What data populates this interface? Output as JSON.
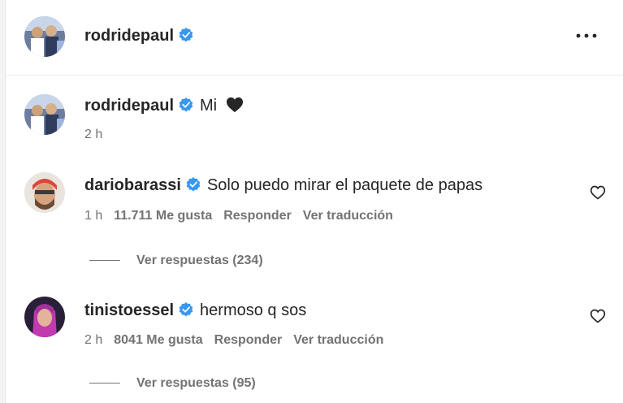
{
  "header": {
    "username": "rodridepaul",
    "more_icon": "more-horizontal-icon"
  },
  "caption": {
    "username": "rodridepaul",
    "text": "Mi",
    "emoji_icon": "black-heart-icon",
    "time": "2 h"
  },
  "comments": [
    {
      "username": "dariobarassi",
      "text": "Solo puedo mirar el paquete de papas",
      "time": "1 h",
      "likes": "11.711 Me gusta",
      "reply_label": "Responder",
      "translate_label": "Ver traducción",
      "view_replies": "Ver respuestas (234)"
    },
    {
      "username": "tinistoessel",
      "text": "hermoso q sos",
      "time": "2 h",
      "likes": "8041 Me gusta",
      "reply_label": "Responder",
      "translate_label": "Ver traducción",
      "view_replies": "Ver respuestas (95)"
    }
  ],
  "colors": {
    "verified": "#3897f0",
    "text": "#262626",
    "secondary": "#737373",
    "divider": "#efefef"
  }
}
